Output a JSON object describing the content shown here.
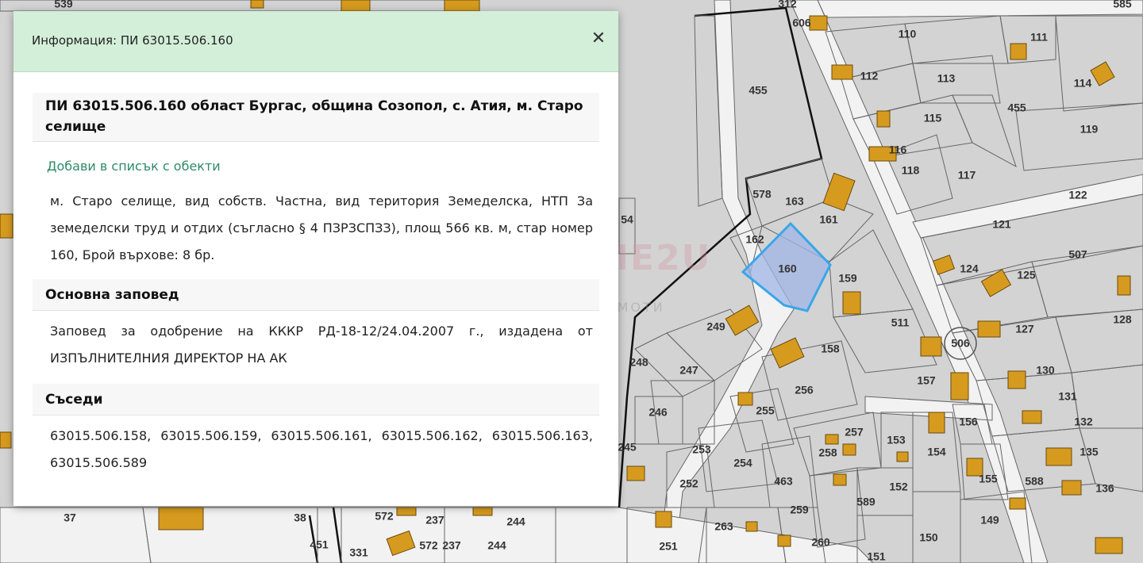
{
  "panel": {
    "header_title": "Информация: ПИ 63015.506.160",
    "close_symbol": "✕",
    "property_title": "ПИ 63015.506.160 област Бургас, община Созопол, с. Атия, м. Старо селище",
    "add_link": "Добави в списък с обекти",
    "description": "м. Старо селище, вид собств. Частна, вид територия Земеделска, НТП За земеделски труд и отдих (съгласно § 4 ПЗРЗСПЗЗ), площ 566 кв. м, стар номер 160, Брой върхове: 8 бр.",
    "order_heading": "Основна заповед",
    "order_text": "Заповед за одобрение на КККР РД-18-12/24.04.2007 г., издадена от ИЗПЪЛНИТЕЛНИЯ ДИРЕКТОР НА АК",
    "neighbors_heading": "Съседи",
    "neighbors_text": "63015.506.158, 63015.506.159, 63015.506.161, 63015.506.162, 63015.506.163, 63015.506.589"
  },
  "map": {
    "selected_parcel": "160",
    "highlight_color": "#3aa6e8",
    "building_color": "#d69b1e",
    "street_number": "506",
    "labels": [
      "539",
      "312",
      "606",
      "585",
      "110",
      "111",
      "112",
      "113",
      "114",
      "455",
      "455",
      "115",
      "116",
      "117",
      "118",
      "119",
      "578",
      "163",
      "161",
      "162",
      "160",
      "159",
      "122",
      "121",
      "124",
      "125",
      "507",
      "249",
      "511",
      "127",
      "128",
      "158",
      "248",
      "247",
      "256",
      "157",
      "130",
      "131",
      "246",
      "255",
      "257",
      "153",
      "154",
      "156",
      "132",
      "245",
      "253",
      "254",
      "258",
      "135",
      "252",
      "463",
      "152",
      "155",
      "588",
      "136",
      "589",
      "259",
      "149",
      "37",
      "38",
      "572",
      "237",
      "244",
      "263",
      "260",
      "150",
      "251",
      "451",
      "331",
      "572",
      "237",
      "244",
      "151",
      "54"
    ],
    "watermark": {
      "brand": "HOME2U",
      "hu": "HU",
      "sub": "НЕДВИЖИМИ ИМОТИ"
    }
  }
}
